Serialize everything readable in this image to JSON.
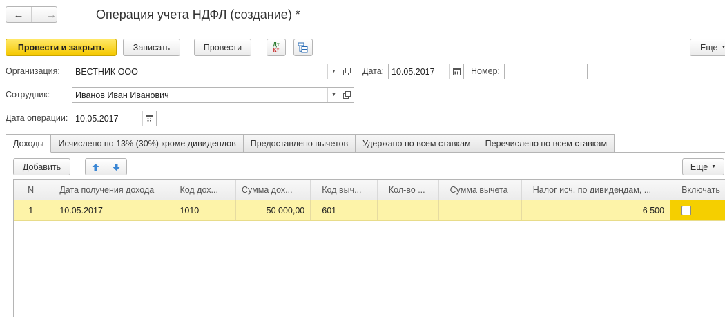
{
  "window": {
    "title": "Операция учета НДФЛ (создание) *"
  },
  "toolbar": {
    "post_close": "Провести и закрыть",
    "save": "Записать",
    "post": "Провести",
    "dtkt_top": "Дт",
    "dtkt_bottom": "Кт",
    "more": "Еще"
  },
  "form": {
    "org_label": "Организация:",
    "org_value": "ВЕСТНИК ООО",
    "date_label": "Дата:",
    "date_value": "10.05.2017",
    "number_label": "Номер:",
    "number_value": "",
    "employee_label": "Сотрудник:",
    "employee_value": "Иванов Иван Иванович",
    "op_date_label": "Дата операции:",
    "op_date_value": "10.05.2017"
  },
  "tabs": [
    {
      "label": "Доходы",
      "active": true
    },
    {
      "label": "Исчислено по 13% (30%) кроме дивидендов"
    },
    {
      "label": "Предоставлено вычетов"
    },
    {
      "label": "Удержано по всем ставкам"
    },
    {
      "label": "Перечислено по всем ставкам"
    }
  ],
  "table_toolbar": {
    "add": "Добавить",
    "more": "Еще"
  },
  "table": {
    "columns": [
      "N",
      "Дата получения дохода",
      "Код дох...",
      "Сумма дох...",
      "Код выч...",
      "Кол-во ...",
      "Сумма вычета",
      "Налог исч. по дивидендам, ...",
      "Включать"
    ],
    "rows": [
      {
        "n": "1",
        "date": "10.05.2017",
        "code": "1010",
        "sum": "50 000,00",
        "ded_code": "601",
        "qty": "",
        "ded_sum": "",
        "tax": "6 500",
        "include": false
      }
    ]
  },
  "colors": {
    "accent": "#f5c800",
    "selected_row": "#fdf3a8"
  },
  "icons": [
    "arrow-left-icon",
    "arrow-right-icon",
    "dtkt-icon",
    "structure-icon",
    "chevron-down-icon",
    "open-icon",
    "calendar-icon",
    "arrow-up-icon",
    "arrow-down-icon"
  ]
}
